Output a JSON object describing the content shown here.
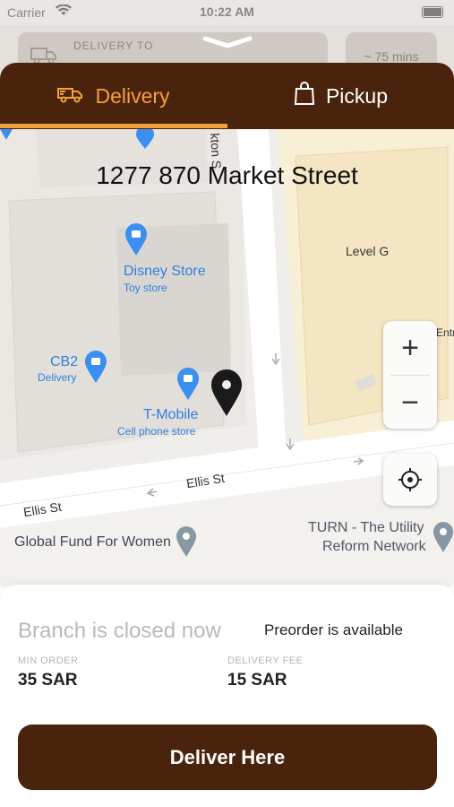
{
  "status_bar": {
    "carrier": "Carrier",
    "time": "10:22 AM"
  },
  "background_card": {
    "delivery_to_label": "DELIVERY TO",
    "eta": "~ 75 mins"
  },
  "tabs": [
    {
      "label": "Delivery",
      "icon": "truck-icon",
      "active": true
    },
    {
      "label": "Pickup",
      "icon": "shopping-bag-icon",
      "active": false
    }
  ],
  "colors": {
    "brand_brown": "#4a230c",
    "accent_orange": "#f5a03a"
  },
  "map": {
    "address": "1277 870 Market Street",
    "pois": [
      {
        "name": "Disney Store",
        "category": "Toy store"
      },
      {
        "name": "CB2",
        "category": "Delivery"
      },
      {
        "name": "T-Mobile",
        "category": "Cell phone store"
      },
      {
        "name": "Global Fund For Women",
        "category": ""
      },
      {
        "name": "TURN - The Utility",
        "category": "Reform Network"
      }
    ],
    "labels": {
      "level": "Level G",
      "street1": "Ellis St",
      "street2": "Ellis St",
      "street_vertical": "kton S",
      "entry": "Entr"
    },
    "controls": {
      "zoom_in": "+",
      "zoom_out": "−"
    }
  },
  "panel": {
    "status": "Branch is closed now",
    "preorder": "Preorder is available",
    "min_order_label": "MIN ORDER",
    "min_order_value": "35 SAR",
    "delivery_fee_label": "DELIVERY FEE",
    "delivery_fee_value": "15 SAR",
    "cta": "Deliver Here"
  }
}
